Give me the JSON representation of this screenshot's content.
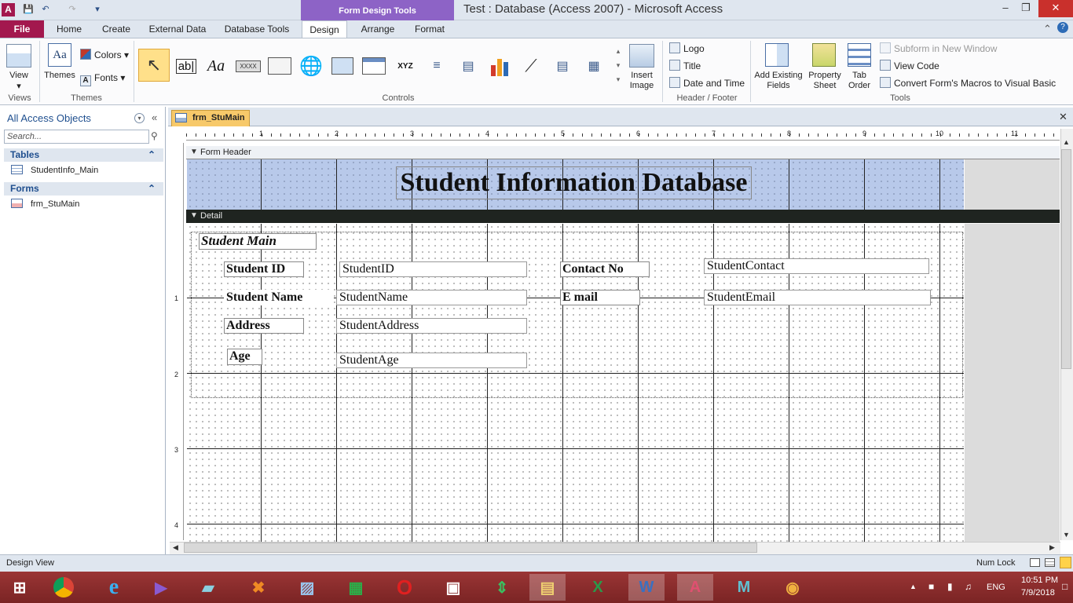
{
  "window": {
    "title": "Test : Database (Access 2007)  -  Microsoft Access",
    "context_header": "Form Design Tools",
    "app_icon": "A",
    "qat_icons": [
      "save-icon",
      "undo-icon",
      "redo-icon",
      "customize-icon"
    ],
    "controls": {
      "minimize": "–",
      "restore": "❐",
      "close": "✕"
    }
  },
  "tabs": [
    "File",
    "Home",
    "Create",
    "External Data",
    "Database Tools",
    "Design",
    "Arrange",
    "Format"
  ],
  "active_tab": "Design",
  "ribbon": {
    "views": {
      "view_label": "View",
      "group": "Views"
    },
    "themes": {
      "themes_label": "Themes",
      "colors_label": "Colors",
      "fonts_label": "Fonts",
      "group": "Themes"
    },
    "controls": {
      "group": "Controls",
      "insert_image_label": "Insert",
      "insert_image_label2": "Image"
    },
    "header_footer": {
      "logo": "Logo",
      "title": "Title",
      "date_time": "Date and Time",
      "group": "Header / Footer"
    },
    "tools": {
      "add_fields": "Add Existing",
      "add_fields2": "Fields",
      "property": "Property",
      "property2": "Sheet",
      "tab_order": "Tab",
      "tab_order2": "Order",
      "subform": "Subform in New Window",
      "view_code": "View Code",
      "convert": "Convert Form's Macros to Visual Basic",
      "group": "Tools"
    }
  },
  "nav": {
    "title": "All Access Objects",
    "search_placeholder": "Search...",
    "sections": [
      {
        "label": "Tables",
        "items": [
          "StudentInfo_Main"
        ]
      },
      {
        "label": "Forms",
        "items": [
          "frm_StuMain"
        ]
      }
    ]
  },
  "document": {
    "tab": "frm_StuMain",
    "form_header_label": "Form Header",
    "detail_label": "Detail",
    "title_label": "Student Information Database",
    "subtitle_label": "Student Main",
    "ruler_h": [
      "1",
      "2",
      "3",
      "4",
      "5",
      "6",
      "7",
      "8",
      "9",
      "10",
      "11"
    ],
    "ruler_v": [
      "1",
      "2",
      "3",
      "4"
    ],
    "fields": {
      "student_id_label": "Student ID",
      "student_id_box": "StudentID",
      "student_name_label": "Student Name",
      "student_name_box": "StudentName",
      "address_label": "Address",
      "address_box": "StudentAddress",
      "age_label": "Age",
      "age_box": "StudentAge",
      "contact_label": "Contact No",
      "contact_box": "StudentContact",
      "email_label": "E mail",
      "email_box": "StudentEmail"
    }
  },
  "status": {
    "left": "Design View",
    "numlock": "Num Lock"
  },
  "taskbar": {
    "apps": [
      "windows-icon",
      "chrome-icon",
      "ie-icon",
      "visual-studio-icon",
      "notepad-icon",
      "xampp-icon",
      "remote-icon",
      "store-icon",
      "opera-icon",
      "photos-icon",
      "transfer-icon",
      "explorer-icon",
      "excel-icon",
      "word-icon",
      "access-icon",
      "media-icon",
      "paint-icon"
    ],
    "lang": "ENG",
    "time": "10:51 PM",
    "date": "7/9/2018"
  },
  "colors": {
    "file_tab": "#a3184e",
    "context": "#8d63c6",
    "doctab": "#f7c96a",
    "taskbar": "#8a2c2c",
    "header_grid": "#b8c9ea"
  }
}
